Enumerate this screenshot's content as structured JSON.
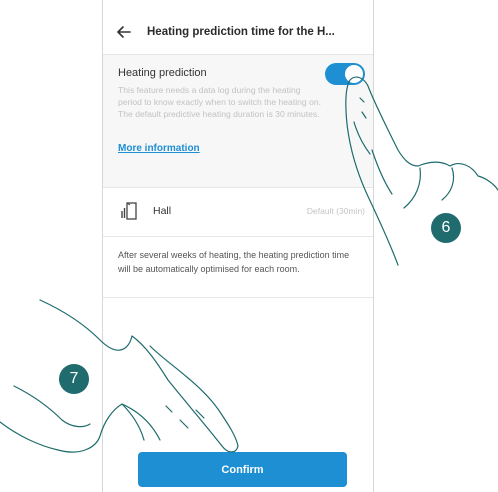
{
  "header": {
    "back_icon": "arrow-left-icon",
    "title": "Heating prediction time for the H..."
  },
  "prediction": {
    "label": "Heating prediction",
    "enabled": true,
    "description": "This feature needs a data log during the heating period to know exactly when to switch the heating on. The default predictive heating duration is 30 minutes.",
    "more_info": "More information"
  },
  "room": {
    "icon": "room-door-icon",
    "name": "Hall",
    "value": "Default (30min)"
  },
  "note": "After several weeks of heating, the heating prediction time will be automatically optimised for each room.",
  "confirm_label": "Confirm",
  "steps": [
    "6",
    "7"
  ],
  "colors": {
    "accent": "#1e8fd3",
    "step_badge": "#1f6b6d",
    "hand_outline": "#1f6b6d"
  }
}
